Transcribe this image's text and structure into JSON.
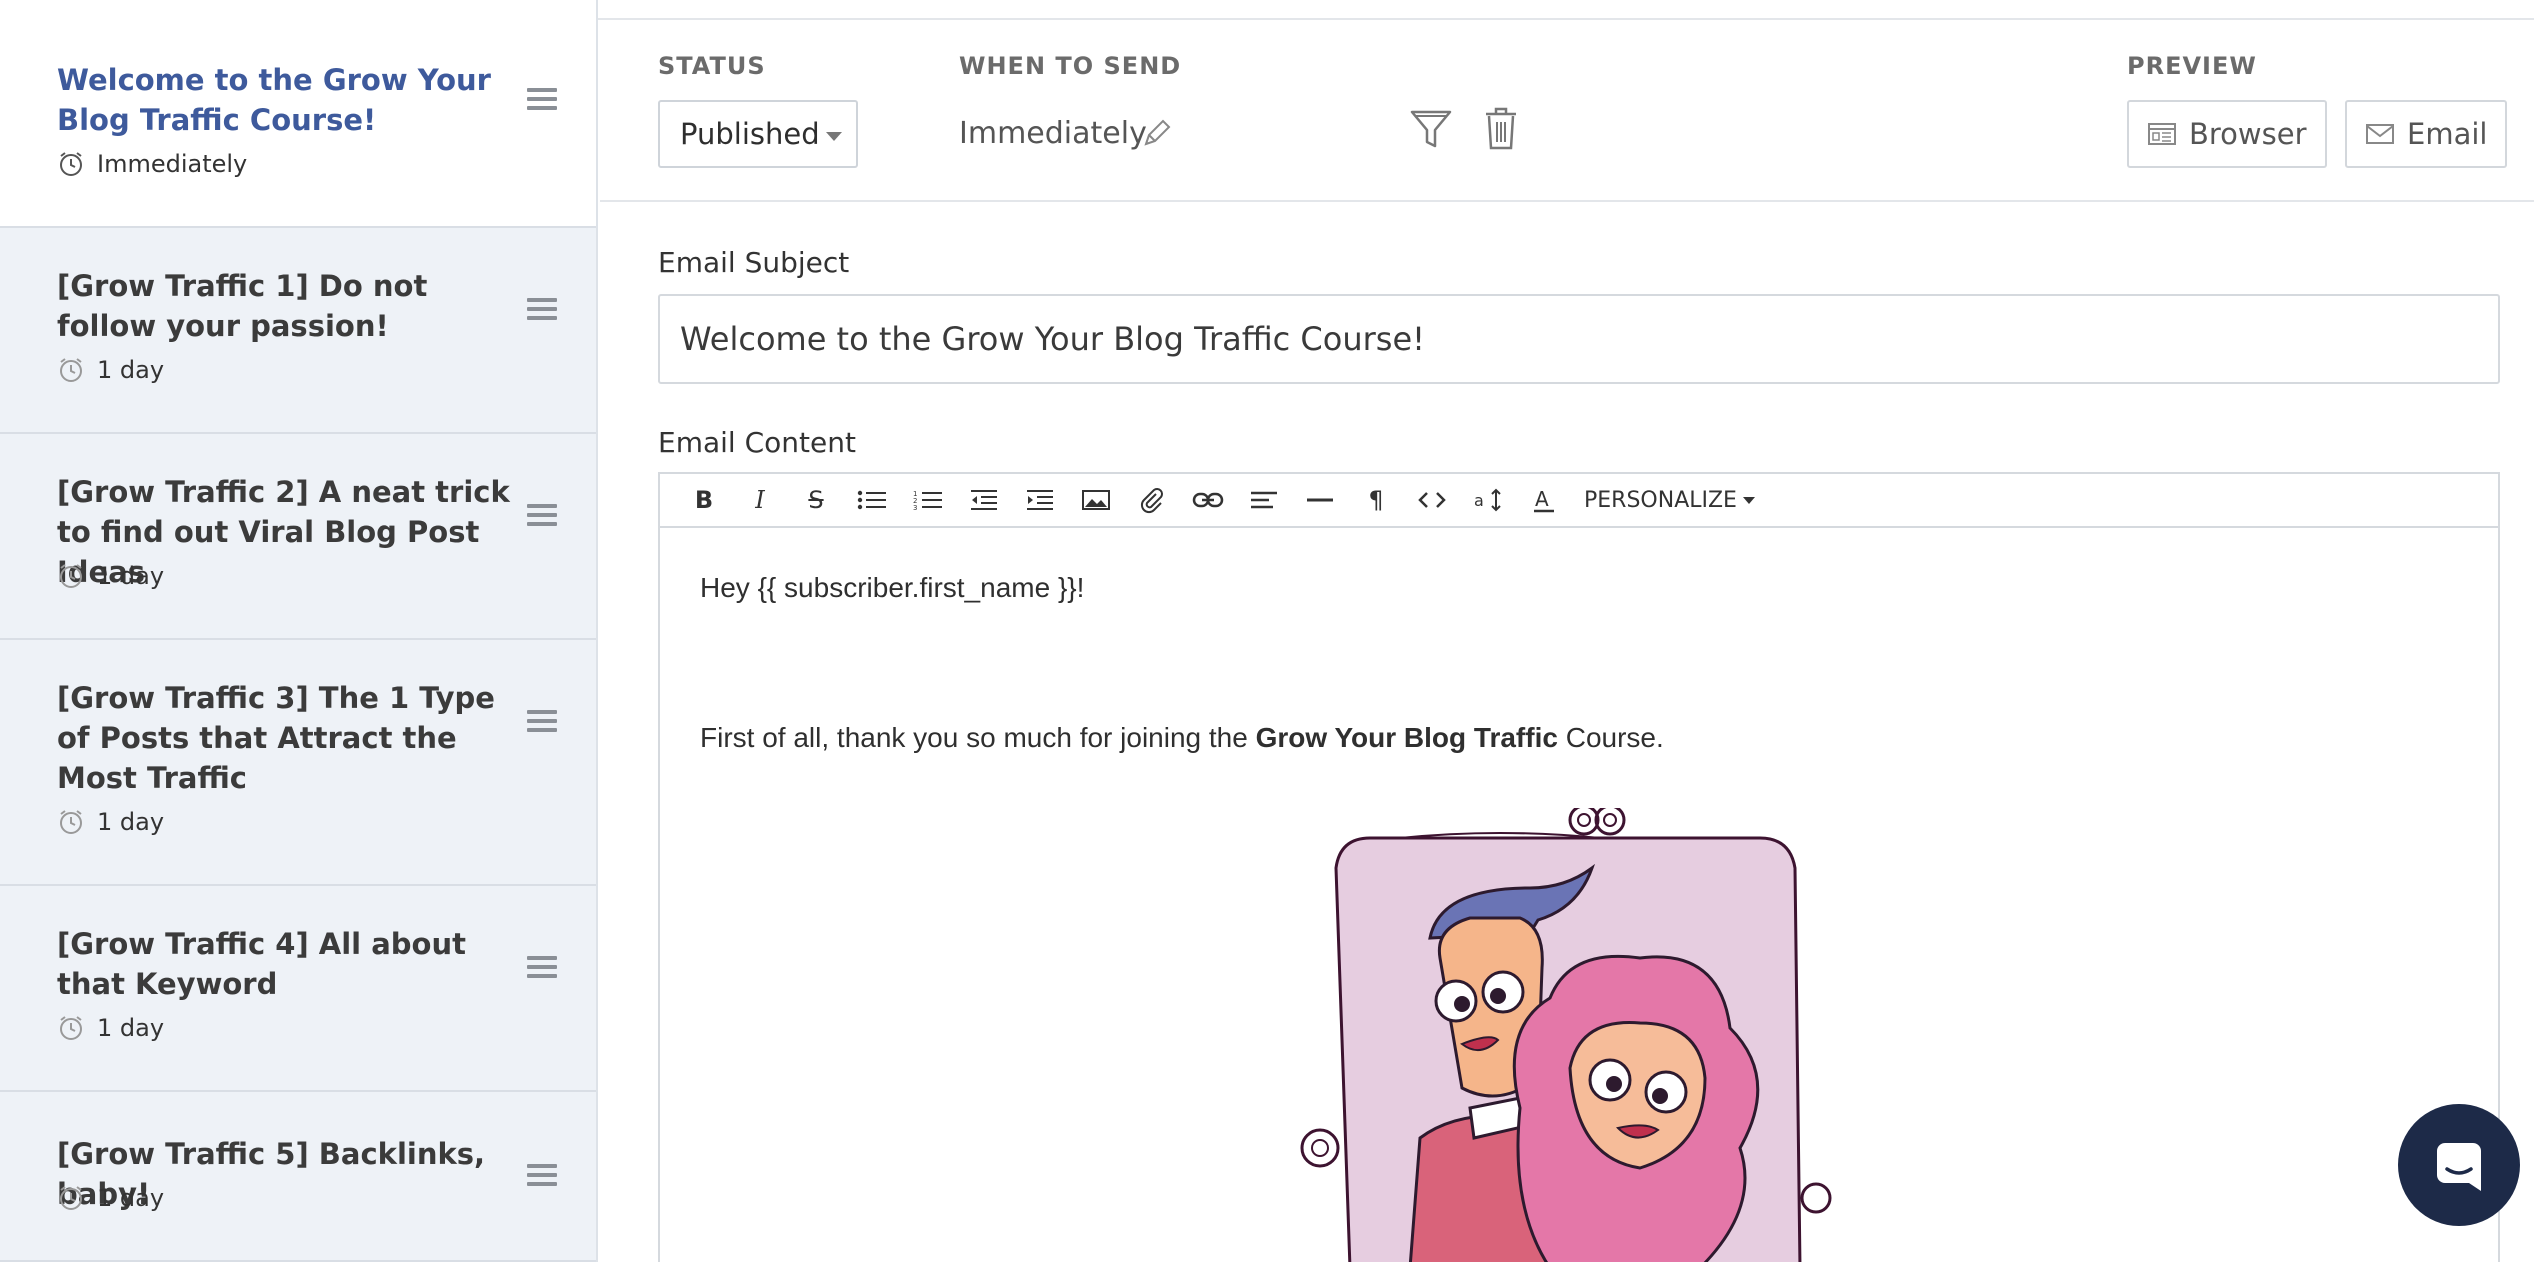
{
  "sidebar": {
    "items": [
      {
        "title": "Welcome to the Grow Your Blog Traffic Course!",
        "delay": "Immediately"
      },
      {
        "title": "[Grow Traffic 1] Do not follow your passion!",
        "delay": "1 day"
      },
      {
        "title": "[Grow Traffic 2] A neat trick to find out Viral Blog Post Ideas",
        "delay": "1 day"
      },
      {
        "title": "[Grow Traffic 3] The 1 Type of Posts that Attract the Most Traffic",
        "delay": "1 day"
      },
      {
        "title": "[Grow Traffic 4] All about that Keyword",
        "delay": "1 day"
      },
      {
        "title": "[Grow Traffic 5] Backlinks, baby!",
        "delay": "1 day"
      }
    ]
  },
  "header": {
    "status_label": "STATUS",
    "status_value": "Published",
    "when_label": "WHEN TO SEND",
    "when_value": "Immediately",
    "preview_label": "PREVIEW",
    "preview_browser": "Browser",
    "preview_email": "Email"
  },
  "form": {
    "subject_label": "Email Subject",
    "subject_value": "Welcome to the Grow Your Blog Traffic Course!",
    "content_label": "Email Content"
  },
  "editor": {
    "toolbar": [
      "B",
      "I",
      "S",
      "bullet-list",
      "numbered-list",
      "outdent",
      "indent",
      "image",
      "attachment",
      "link",
      "align",
      "horizontal-rule",
      "paragraph",
      "code",
      "font-size",
      "text-color"
    ],
    "personalize": "PERSONALIZE",
    "greeting": "Hey {{ subscriber.first_name }}!",
    "intro_before": "First of all, thank you so much for joining the ",
    "intro_bold": "Grow Your Blog Traffic",
    "intro_after": " Course."
  },
  "colors": {
    "active_title": "#3e5a9c",
    "sidebar_bg": "#eef2f7",
    "chat_bg": "#1d2a48"
  }
}
